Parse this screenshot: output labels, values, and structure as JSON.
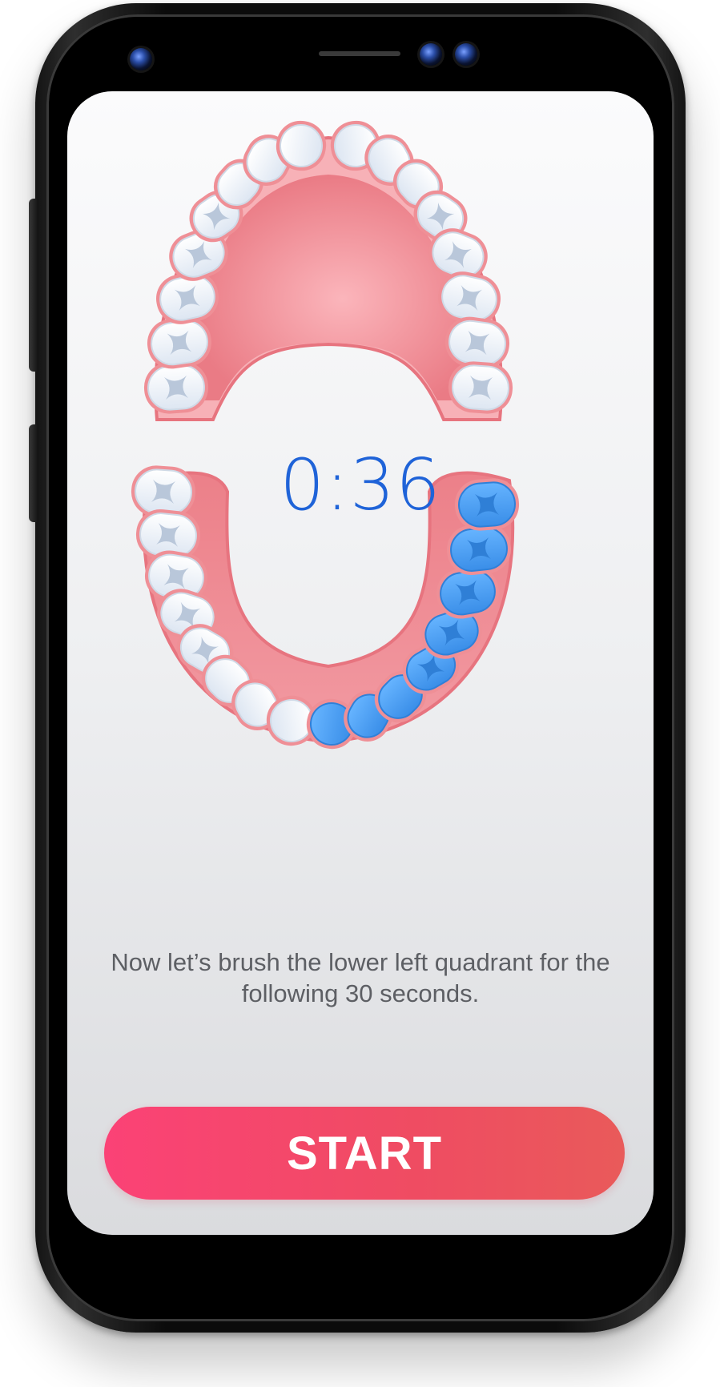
{
  "timer": {
    "text": "0:36"
  },
  "instruction": {
    "text": "Now let’s brush the lower left quadrant for the following 30 seconds."
  },
  "start_button": {
    "label": "START"
  },
  "brushing": {
    "current_quadrant": "lower-left",
    "upper_teeth_count": 16,
    "lower_teeth_count": 16,
    "lower_highlighted_teeth": 8
  },
  "colors": {
    "timer": "#1f63d8",
    "gum": "#ef8f96",
    "tooth": "#ffffff",
    "highlight_tooth": "#4aa0f0",
    "start_gradient_start": "#fb4276",
    "start_gradient_end": "#e95a5a",
    "instruction_text": "#5d5f64"
  },
  "icons": [
    "upper-jaw-icon",
    "lower-jaw-icon",
    "tooth-icon"
  ]
}
